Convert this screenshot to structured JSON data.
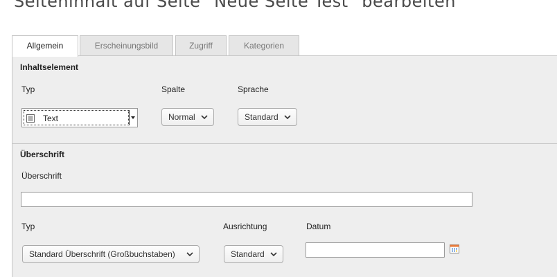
{
  "page": {
    "title": "Seiteninhalt auf Seite \"Neue Seite Test\" bearbeiten"
  },
  "tabs": [
    {
      "label": "Allgemein",
      "active": true
    },
    {
      "label": "Erscheinungsbild",
      "active": false
    },
    {
      "label": "Zugriff",
      "active": false
    },
    {
      "label": "Kategorien",
      "active": false
    }
  ],
  "content_element": {
    "title": "Inhaltselement",
    "type_label": "Typ",
    "type_value": "Text",
    "column_label": "Spalte",
    "column_value": "Normal",
    "language_label": "Sprache",
    "language_value": "Standard"
  },
  "heading_section": {
    "title": "Überschrift",
    "heading_label": "Überschrift",
    "heading_value": "",
    "type_label": "Typ",
    "type_value": "Standard Überschrift (Großbuchstaben)",
    "alignment_label": "Ausrichtung",
    "alignment_value": "Standard",
    "date_label": "Datum",
    "date_value": ""
  },
  "icons": {
    "type": "text-document-icon",
    "chevron": "chevron-down-icon",
    "calendar": "calendar-icon"
  }
}
